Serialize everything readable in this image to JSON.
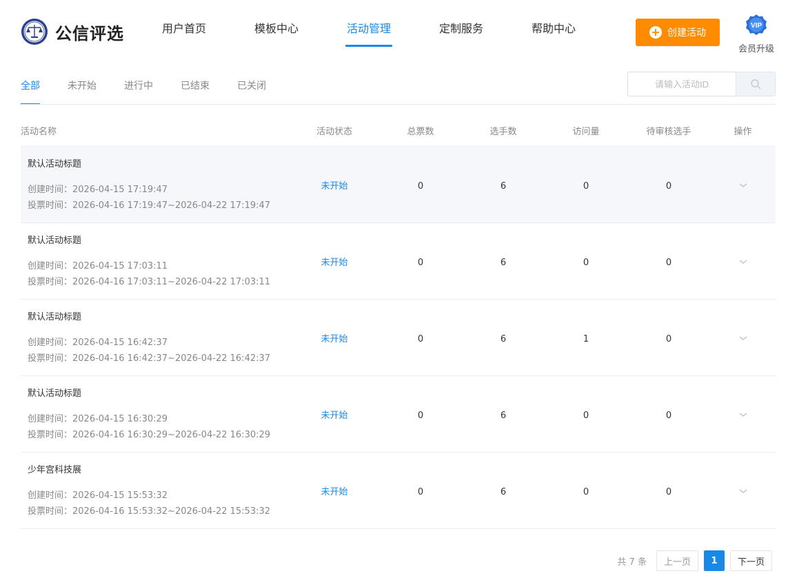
{
  "header": {
    "brand": "公信评选",
    "nav": [
      {
        "label": "用户首页",
        "active": false
      },
      {
        "label": "模板中心",
        "active": false
      },
      {
        "label": "活动管理",
        "active": true
      },
      {
        "label": "定制服务",
        "active": false
      },
      {
        "label": "帮助中心",
        "active": false
      }
    ],
    "create_label": "创建活动",
    "vip_badge": "VIP",
    "vip_label": "会员升级"
  },
  "tabs": [
    {
      "label": "全部",
      "active": true
    },
    {
      "label": "未开始",
      "active": false
    },
    {
      "label": "进行中",
      "active": false
    },
    {
      "label": "已结束",
      "active": false
    },
    {
      "label": "已关闭",
      "active": false
    }
  ],
  "search": {
    "placeholder": "请输入活动ID"
  },
  "table": {
    "headers": [
      "活动名称",
      "活动状态",
      "总票数",
      "选手数",
      "访问量",
      "待审核选手",
      "操作"
    ],
    "rows": [
      {
        "title": "默认活动标题",
        "created": "创建时间：2026-04-15 17:19:47",
        "vote": "投票时间：2026-04-16 17:19:47~2026-04-22 17:19:47",
        "status": "未开始",
        "votes": "0",
        "players": "6",
        "visits": "0",
        "pending": "0"
      },
      {
        "title": "默认活动标题",
        "created": "创建时间：2026-04-15 17:03:11",
        "vote": "投票时间：2026-04-16 17:03:11~2026-04-22 17:03:11",
        "status": "未开始",
        "votes": "0",
        "players": "6",
        "visits": "0",
        "pending": "0"
      },
      {
        "title": "默认活动标题",
        "created": "创建时间：2026-04-15 16:42:37",
        "vote": "投票时间：2026-04-16 16:42:37~2026-04-22 16:42:37",
        "status": "未开始",
        "votes": "0",
        "players": "6",
        "visits": "1",
        "pending": "0"
      },
      {
        "title": "默认活动标题",
        "created": "创建时间：2026-04-15 16:30:29",
        "vote": "投票时间：2026-04-16 16:30:29~2026-04-22 16:30:29",
        "status": "未开始",
        "votes": "0",
        "players": "6",
        "visits": "0",
        "pending": "0"
      },
      {
        "title": "少年宫科技展",
        "created": "创建时间：2026-04-15 15:53:32",
        "vote": "投票时间：2026-04-16 15:53:32~2026-04-22 15:53:32",
        "status": "未开始",
        "votes": "0",
        "players": "6",
        "visits": "0",
        "pending": "0"
      }
    ]
  },
  "pagination": {
    "total": "共 7 条",
    "prev": "上一页",
    "current": "1",
    "next": "下一页"
  },
  "colors": {
    "accent": "#1989e8",
    "create_button": "#ff8c00",
    "vip": "#2b6fd6"
  }
}
